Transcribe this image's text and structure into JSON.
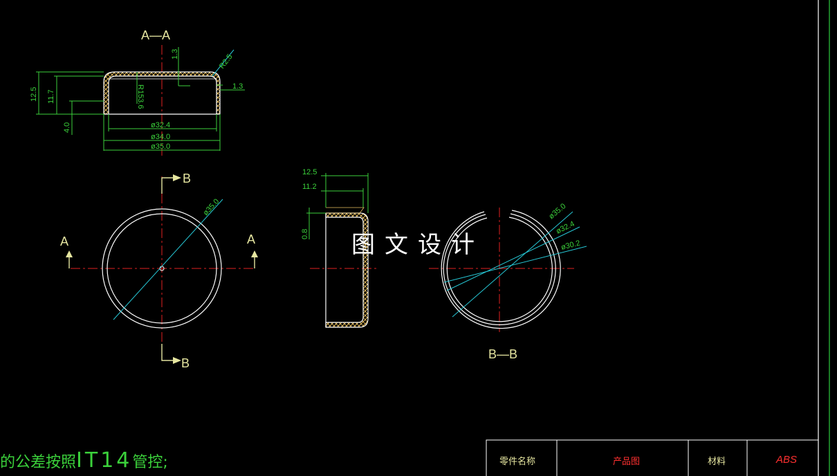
{
  "views": {
    "aa_title": "A—A",
    "bb_title": "B—B",
    "cut_a_left": "A",
    "cut_a_right": "A",
    "cut_b_top": "B",
    "cut_b_bottom": "B"
  },
  "dimensions": {
    "aa": {
      "d_32_4": "ø32.4",
      "d_34_0": "ø34.0",
      "d_35_0": "ø35.0",
      "h_12_5": "12.5",
      "h_11_7": "11.7",
      "h_4_0": "4.0",
      "t_1_3_top": "1.3",
      "t_1_3_side": "1.3",
      "r_2_5": "R2.5",
      "r_153_6": "R153.6"
    },
    "front": {
      "d_35_0": "ø35.0"
    },
    "side": {
      "h_12_5": "12.5",
      "h_11_2": "11.2",
      "h_0_8": "0.8"
    },
    "bb": {
      "d_35_0": "ø35.0",
      "d_32_4": "ø32.4",
      "d_30_2": "ø30.2"
    }
  },
  "watermark": "图文设计",
  "note": {
    "prefix": "的公差按照",
    "grade": "IT14",
    "suffix": "管控;"
  },
  "title_block": {
    "part_name_label": "零件名称",
    "part_name_value": "产品图",
    "material_label": "材料",
    "material_value": "ABS"
  },
  "colors": {
    "background": "#000000",
    "outline": "#ffffff",
    "dimension": "#3bd13b",
    "leader": "#26c6d4",
    "center_line": "#e02020",
    "section_label": "#e6e6a0",
    "title_value": "#ff3030",
    "border": "#2ecc40"
  }
}
